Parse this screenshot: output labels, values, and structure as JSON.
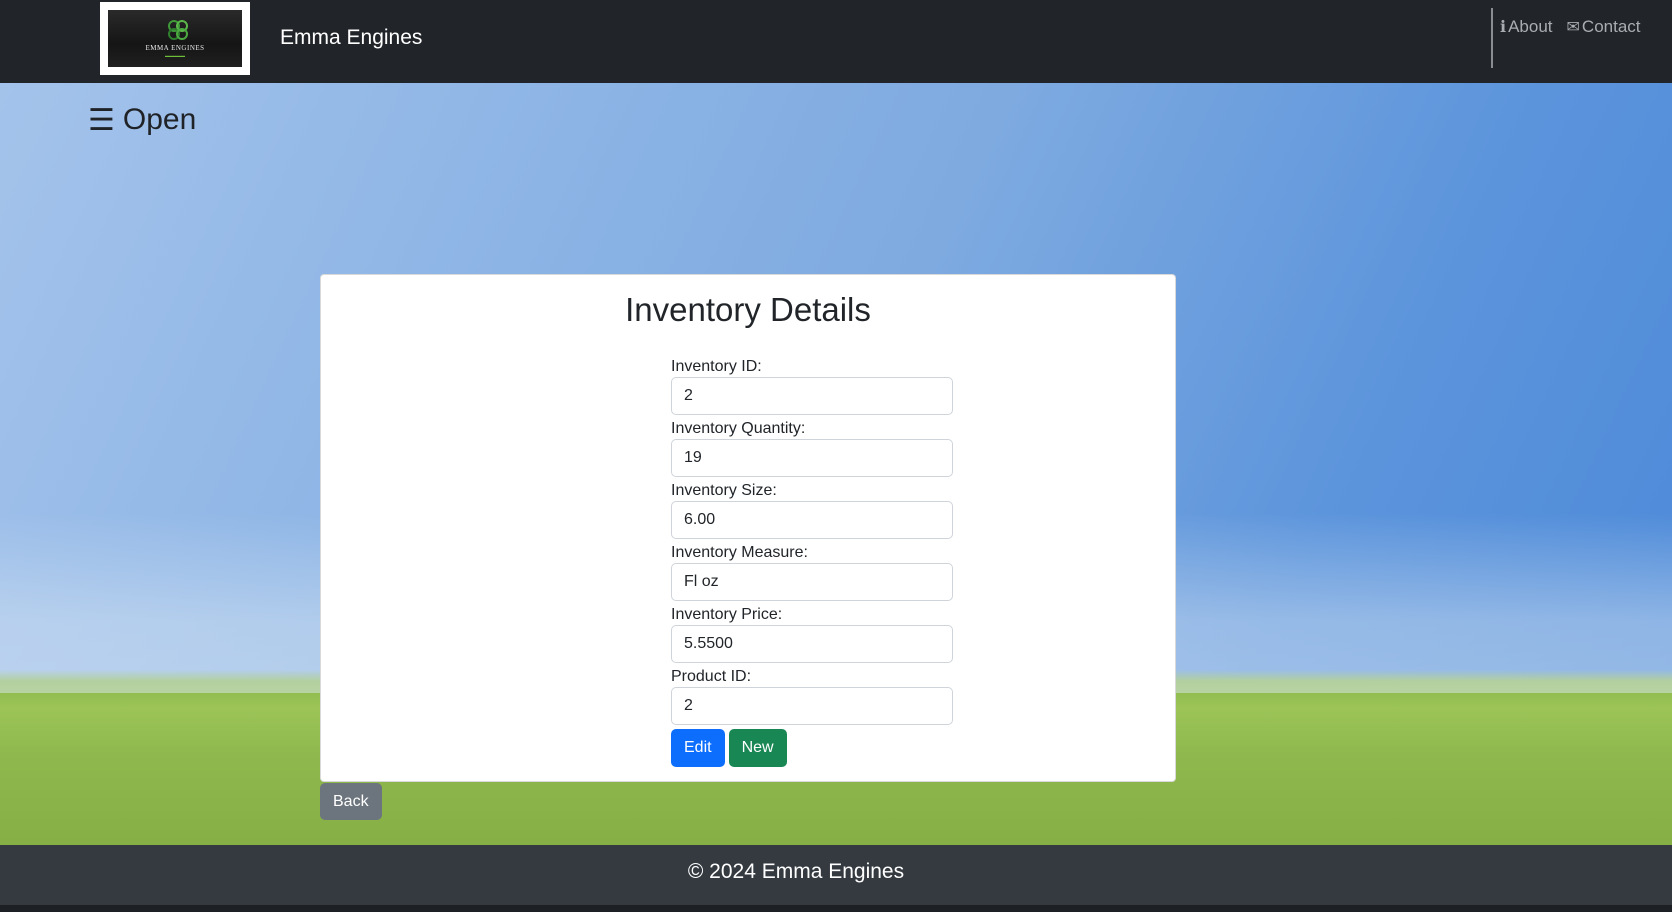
{
  "header": {
    "logo_text": "EMMA ENGINES",
    "brand": "Emma Engines",
    "nav": [
      {
        "icon": "info-icon",
        "label": "About"
      },
      {
        "icon": "envelope-icon",
        "label": "Contact"
      }
    ]
  },
  "sidebar_toggle": {
    "icon": "hamburger-icon",
    "label": "Open"
  },
  "card": {
    "title": "Inventory Details",
    "fields": [
      {
        "label": "Inventory ID:",
        "value": "2"
      },
      {
        "label": "Inventory Quantity:",
        "value": "19"
      },
      {
        "label": "Inventory Size:",
        "value": "6.00"
      },
      {
        "label": "Inventory Measure:",
        "value": "Fl oz"
      },
      {
        "label": "Inventory Price:",
        "value": "5.5500"
      },
      {
        "label": "Product ID:",
        "value": "2"
      }
    ],
    "edit_label": "Edit",
    "new_label": "New"
  },
  "back_label": "Back",
  "footer": {
    "text": "© 2024 Emma Engines"
  },
  "colors": {
    "navbar": "#212529",
    "footer": "#343a40",
    "edit_button": "#0d6efd",
    "new_button": "#198754",
    "back_button": "#6c757d"
  }
}
